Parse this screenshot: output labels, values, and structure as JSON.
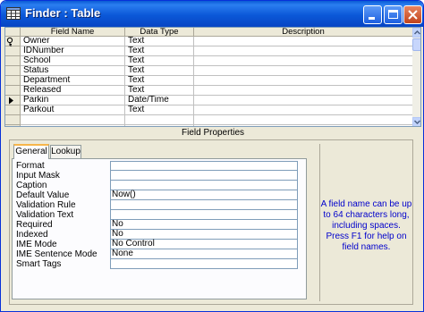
{
  "window": {
    "title": "Finder : Table",
    "title_color": "#ffffff",
    "frame_color": "#0831d9"
  },
  "design_grid": {
    "columns": [
      "Field Name",
      "Data Type",
      "Description"
    ],
    "rows": [
      {
        "field": "Owner",
        "type": "Text",
        "description": "",
        "primary_key": true,
        "current": false
      },
      {
        "field": "IDNumber",
        "type": "Text",
        "description": "",
        "primary_key": false,
        "current": false
      },
      {
        "field": "School",
        "type": "Text",
        "description": "",
        "primary_key": false,
        "current": false
      },
      {
        "field": "Status",
        "type": "Text",
        "description": "",
        "primary_key": false,
        "current": false
      },
      {
        "field": "Department",
        "type": "Text",
        "description": "",
        "primary_key": false,
        "current": false
      },
      {
        "field": "Released",
        "type": "Text",
        "description": "",
        "primary_key": false,
        "current": false
      },
      {
        "field": "Parkin",
        "type": "Date/Time",
        "description": "",
        "primary_key": false,
        "current": true
      },
      {
        "field": "Parkout",
        "type": "Text",
        "description": "",
        "primary_key": false,
        "current": false
      },
      {
        "field": "",
        "type": "",
        "description": "",
        "primary_key": false,
        "current": false
      },
      {
        "field": "",
        "type": "",
        "description": "",
        "primary_key": false,
        "current": false
      }
    ]
  },
  "field_properties": {
    "heading": "Field Properties",
    "tabs": [
      "General",
      "Lookup"
    ],
    "active_tab": "General",
    "properties": [
      {
        "label": "Format",
        "value": ""
      },
      {
        "label": "Input Mask",
        "value": ""
      },
      {
        "label": "Caption",
        "value": ""
      },
      {
        "label": "Default Value",
        "value": "Now()"
      },
      {
        "label": "Validation Rule",
        "value": ""
      },
      {
        "label": "Validation Text",
        "value": ""
      },
      {
        "label": "Required",
        "value": "No"
      },
      {
        "label": "Indexed",
        "value": "No"
      },
      {
        "label": "IME Mode",
        "value": "No Control"
      },
      {
        "label": "IME Sentence Mode",
        "value": "None"
      },
      {
        "label": "Smart Tags",
        "value": ""
      }
    ],
    "help_text": "A field name can be up to 64 characters long, including spaces.  Press F1 for help on field names.",
    "help_color": "#0000cc"
  }
}
